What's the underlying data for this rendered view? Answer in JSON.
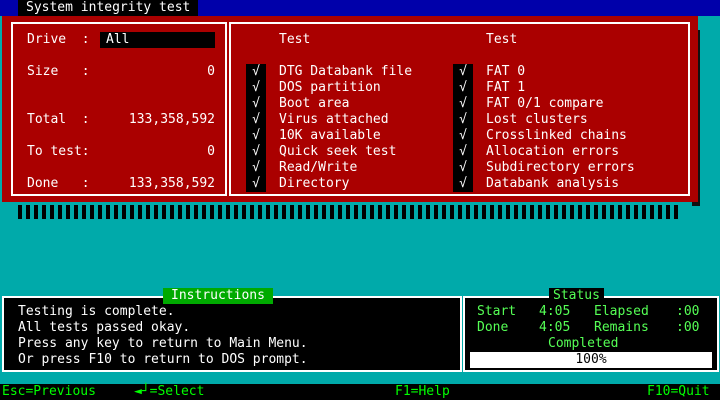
{
  "window": {
    "title": "System integrity test"
  },
  "left_panel": {
    "drive_label": "Drive  :",
    "drive_value": "All",
    "size_label": "Size   :",
    "size_value": "0",
    "total_label": "Total  :",
    "total_value": "133,358,592",
    "to_test_label": "To test:",
    "to_test_value": "0",
    "done_label": "Done   :",
    "done_value": "133,358,592"
  },
  "tests": {
    "col1_header": "Test",
    "col2_header": "Test",
    "check_glyph": "√",
    "col1": [
      "DTG Databank file",
      "DOS partition",
      "Boot area",
      "Virus attached",
      "10K available",
      "Quick seek test",
      "Read/Write",
      "Directory"
    ],
    "col2": [
      "FAT 0",
      "FAT 1",
      "FAT 0/1 compare",
      "Lost clusters",
      "Crosslinked chains",
      "Allocation errors",
      "Subdirectory errors",
      "Databank analysis"
    ]
  },
  "instructions": {
    "title": "Instructions",
    "lines": [
      "Testing is complete.",
      "All tests passed okay.",
      "Press any key to return to Main Menu.",
      "Or press F10 to return to DOS prompt."
    ]
  },
  "status": {
    "title": "Status",
    "start_label": "Start",
    "start_value": "4:05",
    "elapsed_label": "Elapsed",
    "elapsed_value": ":00",
    "done_label": "Done",
    "done_value": "4:05",
    "remains_label": "Remains",
    "remains_value": ":00",
    "completed_title": "Completed",
    "progress_text": "100%"
  },
  "footer": {
    "esc": "Esc=Previous",
    "enter": "◄┘=Select",
    "help": "F1=Help",
    "quit": "F10=Quit"
  },
  "colors": {
    "background": "#00aaaa",
    "panel": "#aa0000",
    "title_bar": "#0000aa",
    "accent_green": "#00aa00"
  }
}
